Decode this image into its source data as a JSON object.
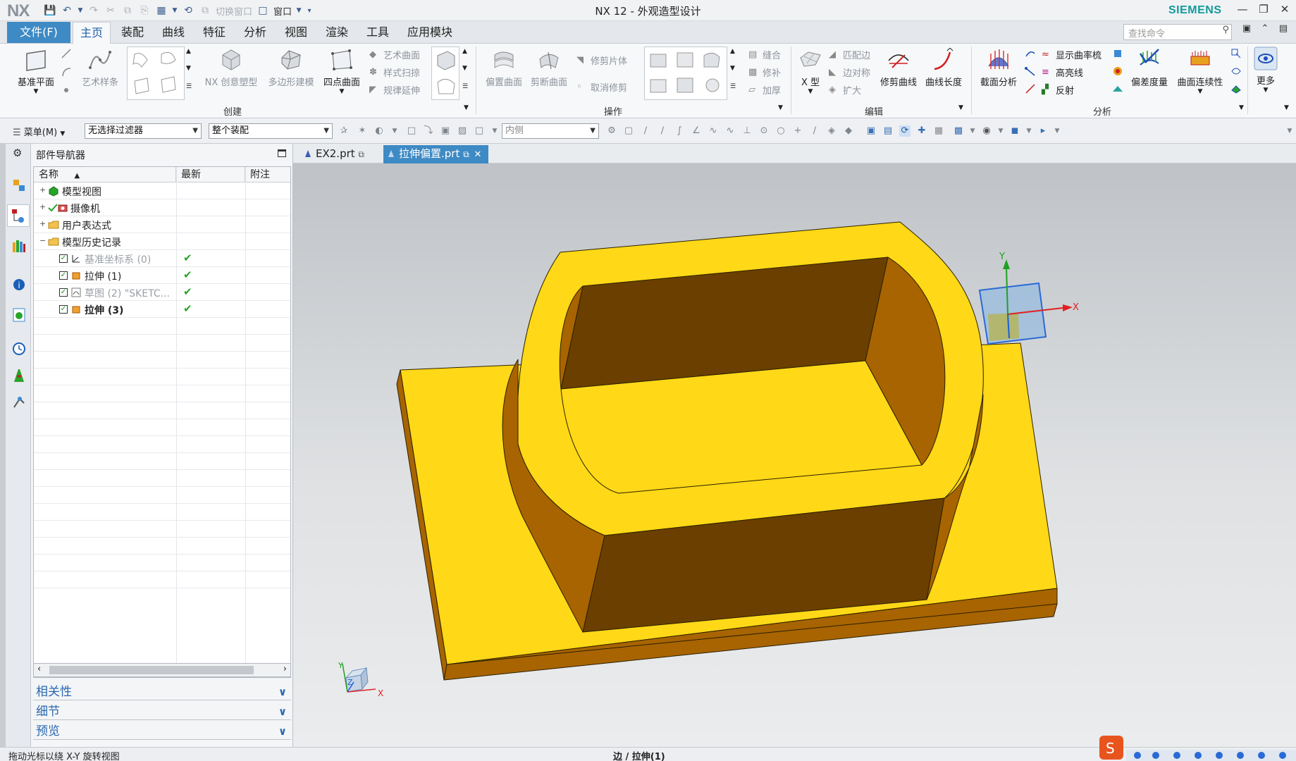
{
  "titlebar": {
    "logo": "NX",
    "title": "NX 12 - 外观造型设计",
    "brand": "SIEMENS",
    "switch_window": "切换窗口",
    "window_menu": "窗口"
  },
  "menu": {
    "file": "文件(F)",
    "tabs": [
      "主页",
      "装配",
      "曲线",
      "特征",
      "分析",
      "视图",
      "渲染",
      "工具",
      "应用模块"
    ],
    "search_placeholder": "查找命令"
  },
  "ribbon": {
    "datum_plane": "基准平面",
    "art_spline": "艺术样条",
    "nx_realize": "NX 创意塑型",
    "poly_model": "多边形建模",
    "two_point_surface": "四点曲面",
    "art_surface": "艺术曲面",
    "styled_sweep": "样式扫掠",
    "law_extension": "规律延伸",
    "group_create": "创建",
    "offset_surface": "偏置曲面",
    "trim_sheet": "剪断曲面",
    "trim_body": "修剪片体",
    "untrim": "取消修剪",
    "sew": "缝合",
    "patch": "修补",
    "thicken": "加厚",
    "group_operation": "操作",
    "x_form": "X 型",
    "match_edge": "匹配边",
    "edge_symmetry": "边对称",
    "enlarge": "扩大",
    "trim_curve": "修剪曲线",
    "curve_length": "曲线长度",
    "group_edit": "编辑",
    "section_analysis": "截面分析",
    "show_comb": "显示曲率梳",
    "highlight_lines": "高亮线",
    "reflection": "反射",
    "deviation_gauge": "偏差度量",
    "surface_continuity": "曲面连续性",
    "more": "更多",
    "group_analysis": "分析"
  },
  "selection": {
    "menu": "菜单(M)",
    "filter": "无选择过滤器",
    "scope": "整个装配",
    "side": "内侧"
  },
  "navigator": {
    "title": "部件导航器",
    "col_name": "名称",
    "col_latest": "最新",
    "col_note": "附注",
    "rows": [
      {
        "label": "模型视图",
        "level": 0,
        "expander": "+",
        "style": "normal",
        "checked": false,
        "latest": ""
      },
      {
        "label": "摄像机",
        "level": 0,
        "expander": "+",
        "style": "normal",
        "checked": false,
        "latest": ""
      },
      {
        "label": "用户表达式",
        "level": 0,
        "expander": "+",
        "style": "normal",
        "checked": false,
        "latest": ""
      },
      {
        "label": "模型历史记录",
        "level": 0,
        "expander": "−",
        "style": "normal",
        "checked": false,
        "latest": ""
      },
      {
        "label": "基准坐标系 (0)",
        "level": 1,
        "expander": "",
        "style": "dim",
        "checked": true,
        "latest": "✔"
      },
      {
        "label": "拉伸 (1)",
        "level": 1,
        "expander": "",
        "style": "normal",
        "checked": true,
        "latest": "✔"
      },
      {
        "label": "草图 (2) \"SKETC...",
        "level": 1,
        "expander": "",
        "style": "dim",
        "checked": true,
        "latest": "✔"
      },
      {
        "label": "拉伸 (3)",
        "level": 1,
        "expander": "",
        "style": "bold",
        "checked": true,
        "latest": "✔"
      }
    ],
    "panels": [
      "相关性",
      "细节",
      "预览"
    ]
  },
  "doc_tabs": [
    {
      "label": "EX2.prt",
      "active": false
    },
    {
      "label": "拉伸偏置.prt",
      "active": true
    }
  ],
  "triad": {
    "x": "X",
    "y": "Y",
    "z": "Z"
  },
  "status": {
    "left": "拖动光标以绕 X-Y 旋转视图",
    "mid": "边 / 拉伸(1)"
  },
  "colors": {
    "accent": "#3e8ac4",
    "model_face": "#ffd817",
    "model_shadow": "#6b3f00",
    "model_side": "#a86400",
    "brand": "#119a9a"
  }
}
